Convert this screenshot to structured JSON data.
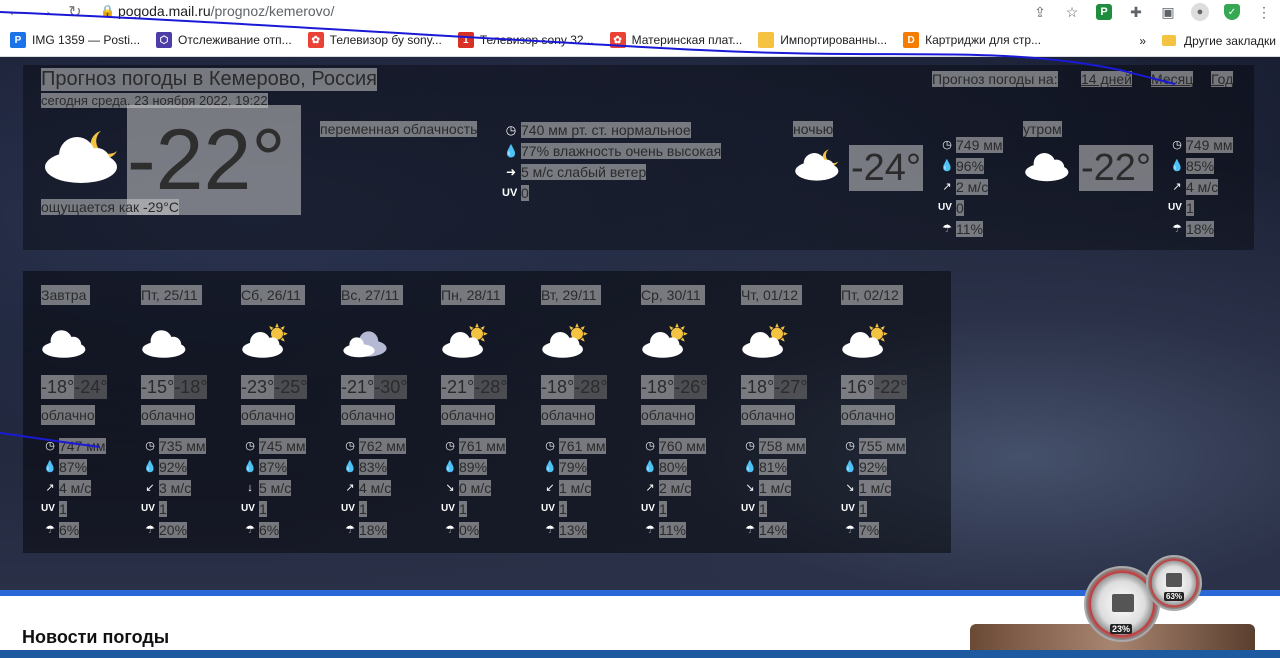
{
  "browser": {
    "url_host": "pogoda.mail.ru",
    "url_path": "/prognoz/kemerovo/",
    "bookmarks": [
      {
        "label": "IMG 1359 — Posti...",
        "color": "#1a73e8",
        "glyph": "P"
      },
      {
        "label": "Отслеживание отп...",
        "color": "#4b3ca7",
        "glyph": "⬡"
      },
      {
        "label": "Телевизор бу sony...",
        "color": "#ea4335",
        "glyph": "✿"
      },
      {
        "label": "Телевизор sony 32...",
        "color": "#d93025",
        "glyph": "1"
      },
      {
        "label": "Материнская плат...",
        "color": "#ea4335",
        "glyph": "✿"
      },
      {
        "label": "Импортированны...",
        "color": "#f5c342",
        "glyph": ""
      },
      {
        "label": "Картриджи для стр...",
        "color": "#f57c00",
        "glyph": "D"
      }
    ],
    "other_bookmarks": "Другие закладки",
    "ext_letter": "P"
  },
  "weather": {
    "title": "Прогноз погоды в Кемерово, Россия",
    "date": "сегодня среда, 23 ноября 2022, 19:22",
    "period_label": "Прогноз погоды на:",
    "period_links": [
      "14 дней",
      "Месяц",
      "Год"
    ],
    "temp": "-22°",
    "feels": "ощущается как -29°C",
    "condition": "переменная облачность",
    "details": {
      "pressure": "740 мм рт. ст. нормальное",
      "humidity": "77% влажность очень высокая",
      "wind": "5 м/с слабый ветер",
      "uv": "0"
    },
    "parts": [
      {
        "label": "ночью",
        "temp": "-24°",
        "pressure": "749 мм",
        "humidity": "96%",
        "wind": "2 м/с",
        "uv": "0",
        "precip": "11%"
      },
      {
        "label": "утром",
        "temp": "-22°",
        "pressure": "749 мм",
        "humidity": "85%",
        "wind": "4 м/с",
        "uv": "1",
        "precip": "18%"
      }
    ],
    "days": [
      {
        "name": "Завтра",
        "max": "-18°",
        "min": "-24°",
        "cond": "облачно",
        "pressure": "747 мм",
        "humidity": "87%",
        "wind": "4 м/с",
        "uv": "1",
        "precip": "6%",
        "icon": "cloud",
        "wind_dir": "↗"
      },
      {
        "name": "Пт, 25/11",
        "max": "-15°",
        "min": "-18°",
        "cond": "облачно",
        "pressure": "735 мм",
        "humidity": "92%",
        "wind": "3 м/с",
        "uv": "1",
        "precip": "20%",
        "icon": "cloud",
        "wind_dir": "↙"
      },
      {
        "name": "Сб, 26/11",
        "max": "-23°",
        "min": "-25°",
        "cond": "облачно",
        "pressure": "745 мм",
        "humidity": "87%",
        "wind": "5 м/с",
        "uv": "1",
        "precip": "6%",
        "icon": "sun-cloud",
        "wind_dir": "↓"
      },
      {
        "name": "Вс, 27/11",
        "max": "-21°",
        "min": "-30°",
        "cond": "облачно",
        "pressure": "762 мм",
        "humidity": "83%",
        "wind": "4 м/с",
        "uv": "1",
        "precip": "18%",
        "icon": "grey-cloud",
        "wind_dir": "↗"
      },
      {
        "name": "Пн, 28/11",
        "max": "-21°",
        "min": "-28°",
        "cond": "облачно",
        "pressure": "761 мм",
        "humidity": "89%",
        "wind": "0 м/с",
        "uv": "1",
        "precip": "0%",
        "icon": "sun-cloud",
        "wind_dir": "↘"
      },
      {
        "name": "Вт, 29/11",
        "max": "-18°",
        "min": "-28°",
        "cond": "облачно",
        "pressure": "761 мм",
        "humidity": "79%",
        "wind": "1 м/с",
        "uv": "1",
        "precip": "13%",
        "icon": "sun-cloud",
        "wind_dir": "↙"
      },
      {
        "name": "Ср, 30/11",
        "max": "-18°",
        "min": "-26°",
        "cond": "облачно",
        "pressure": "760 мм",
        "humidity": "80%",
        "wind": "2 м/с",
        "uv": "1",
        "precip": "11%",
        "icon": "sun-cloud",
        "wind_dir": "↗"
      },
      {
        "name": "Чт, 01/12",
        "max": "-18°",
        "min": "-27°",
        "cond": "облачно",
        "pressure": "758 мм",
        "humidity": "81%",
        "wind": "1 м/с",
        "uv": "1",
        "precip": "14%",
        "icon": "sun-cloud",
        "wind_dir": "↘"
      },
      {
        "name": "Пт, 02/12",
        "max": "-16°",
        "min": "-22°",
        "cond": "облачно",
        "pressure": "755 мм",
        "humidity": "92%",
        "wind": "1 м/с",
        "uv": "1",
        "precip": "7%",
        "icon": "sun-cloud",
        "wind_dir": "↘"
      }
    ],
    "uv_label": "UV"
  },
  "news": {
    "title": "Новости погоды"
  },
  "gadgets": {
    "cpu": "23%",
    "mem": "63%"
  }
}
